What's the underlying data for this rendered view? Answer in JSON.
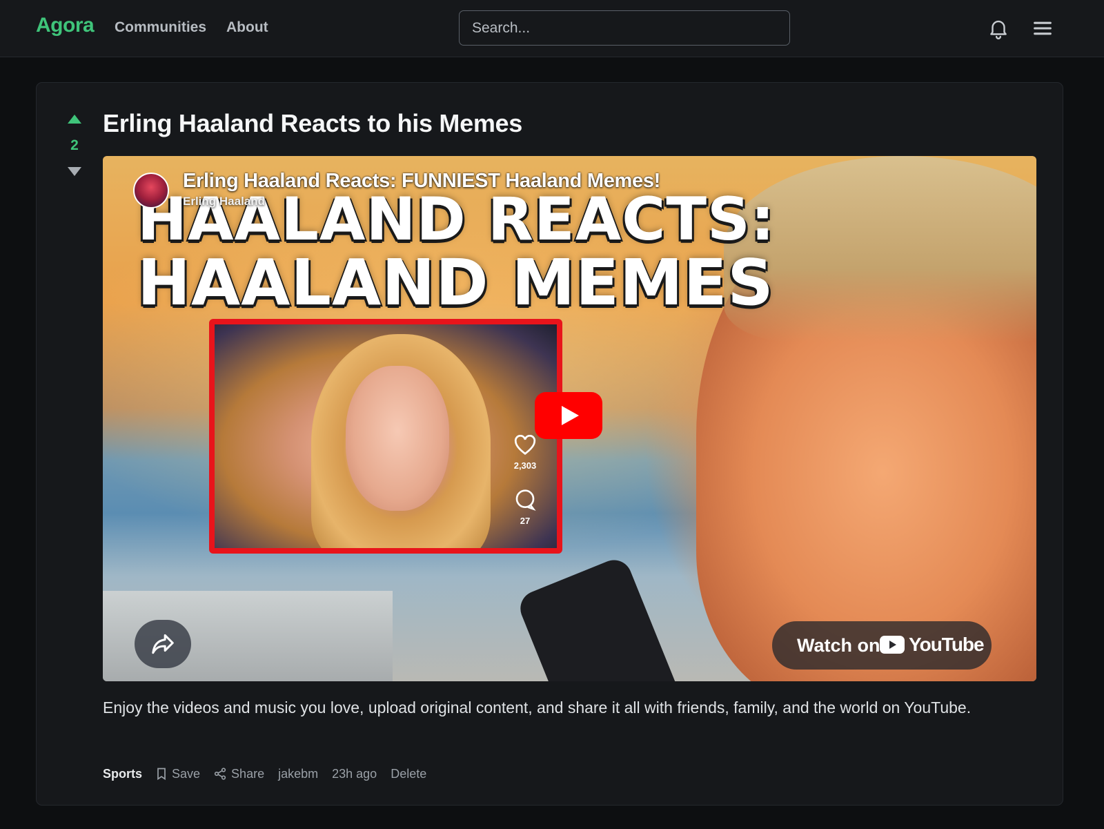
{
  "nav": {
    "logo": "Agora",
    "links": [
      {
        "label": "Communities"
      },
      {
        "label": "About"
      }
    ],
    "search_placeholder": "Search...",
    "icons": [
      "bell-icon",
      "hamburger-menu-icon"
    ]
  },
  "post": {
    "title": "Erling Haaland Reacts to his Memes",
    "score": "2",
    "description": "Enjoy the videos and music you love, upload original content, and share it all with friends, family, and the world on YouTube.",
    "footer": {
      "community": "Sports",
      "save_label": "Save",
      "share_label": "Share",
      "author": "jakebm",
      "time": "23h ago",
      "delete_label": "Delete"
    }
  },
  "video": {
    "title": "Erling Haaland Reacts: FUNNIEST Haaland Memes!",
    "channel": "Erling Haaland",
    "thumbnail_text_line1": "HAALAND REACTS:",
    "thumbnail_text_line2": "HAALAND MEMES",
    "likes": "2,303",
    "comments": "27",
    "watch_on": "Watch on",
    "youtube_word": "YouTube"
  },
  "colors": {
    "accent": "#3fc47a",
    "background": "#0d0f11",
    "card": "#16181b",
    "youtube_red": "#ff0000"
  }
}
